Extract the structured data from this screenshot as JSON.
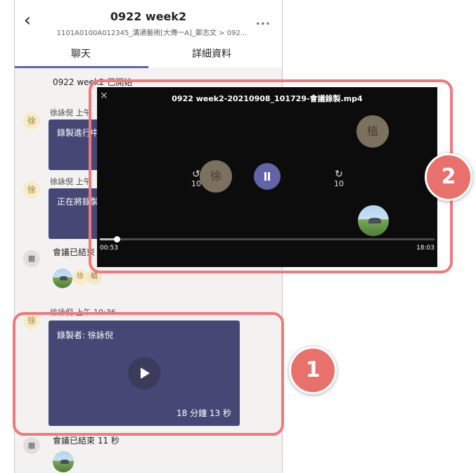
{
  "header": {
    "title": "0922 week2",
    "subtitle": "1101A0100A012345_溝通藝術[大傳一A]_鄭志文 > 092...",
    "back_icon": "chevron-left-icon",
    "more_label": "..."
  },
  "tabs": [
    {
      "label": "聊天",
      "selected": true
    },
    {
      "label": "詳細資料",
      "selected": false
    }
  ],
  "messages": {
    "started": "0922 week2 已開始",
    "msg1": {
      "avatar": "徐",
      "name": "徐詠倪 上午",
      "card_text": "錄製進行中"
    },
    "msg2": {
      "avatar": "徐",
      "name": "徐詠倪 上午",
      "card_text": "正在將錄製"
    },
    "ended1": {
      "text": "會議已結束",
      "icon": "calendar-icon",
      "avatars": [
        "徐",
        "植"
      ]
    },
    "msg3": {
      "avatar": "徐",
      "name": "徐詠倪 上午 10:36",
      "card_text": "錄製者: 徐詠倪",
      "duration": "18 分鐘 13 秒",
      "play_icon": "play-icon"
    },
    "ended2": {
      "text": "會議已結束  11 秒",
      "icon": "calendar-icon"
    }
  },
  "video": {
    "title": "0922 week2-20210908_101729-會議錄製.mp4",
    "close_label": "×",
    "rewind_label": "10",
    "forward_label": "10",
    "pause_icon": "pause-icon",
    "current_time": "00:53",
    "total_time": "18:03",
    "progress": 0.05,
    "participants": [
      "徐",
      "植"
    ]
  },
  "callouts": [
    {
      "number": "1"
    },
    {
      "number": "2"
    }
  ],
  "colors": {
    "accent": "#6264a7",
    "card": "#464775",
    "highlight": "#ee7a80",
    "badge": "#e8716b"
  }
}
